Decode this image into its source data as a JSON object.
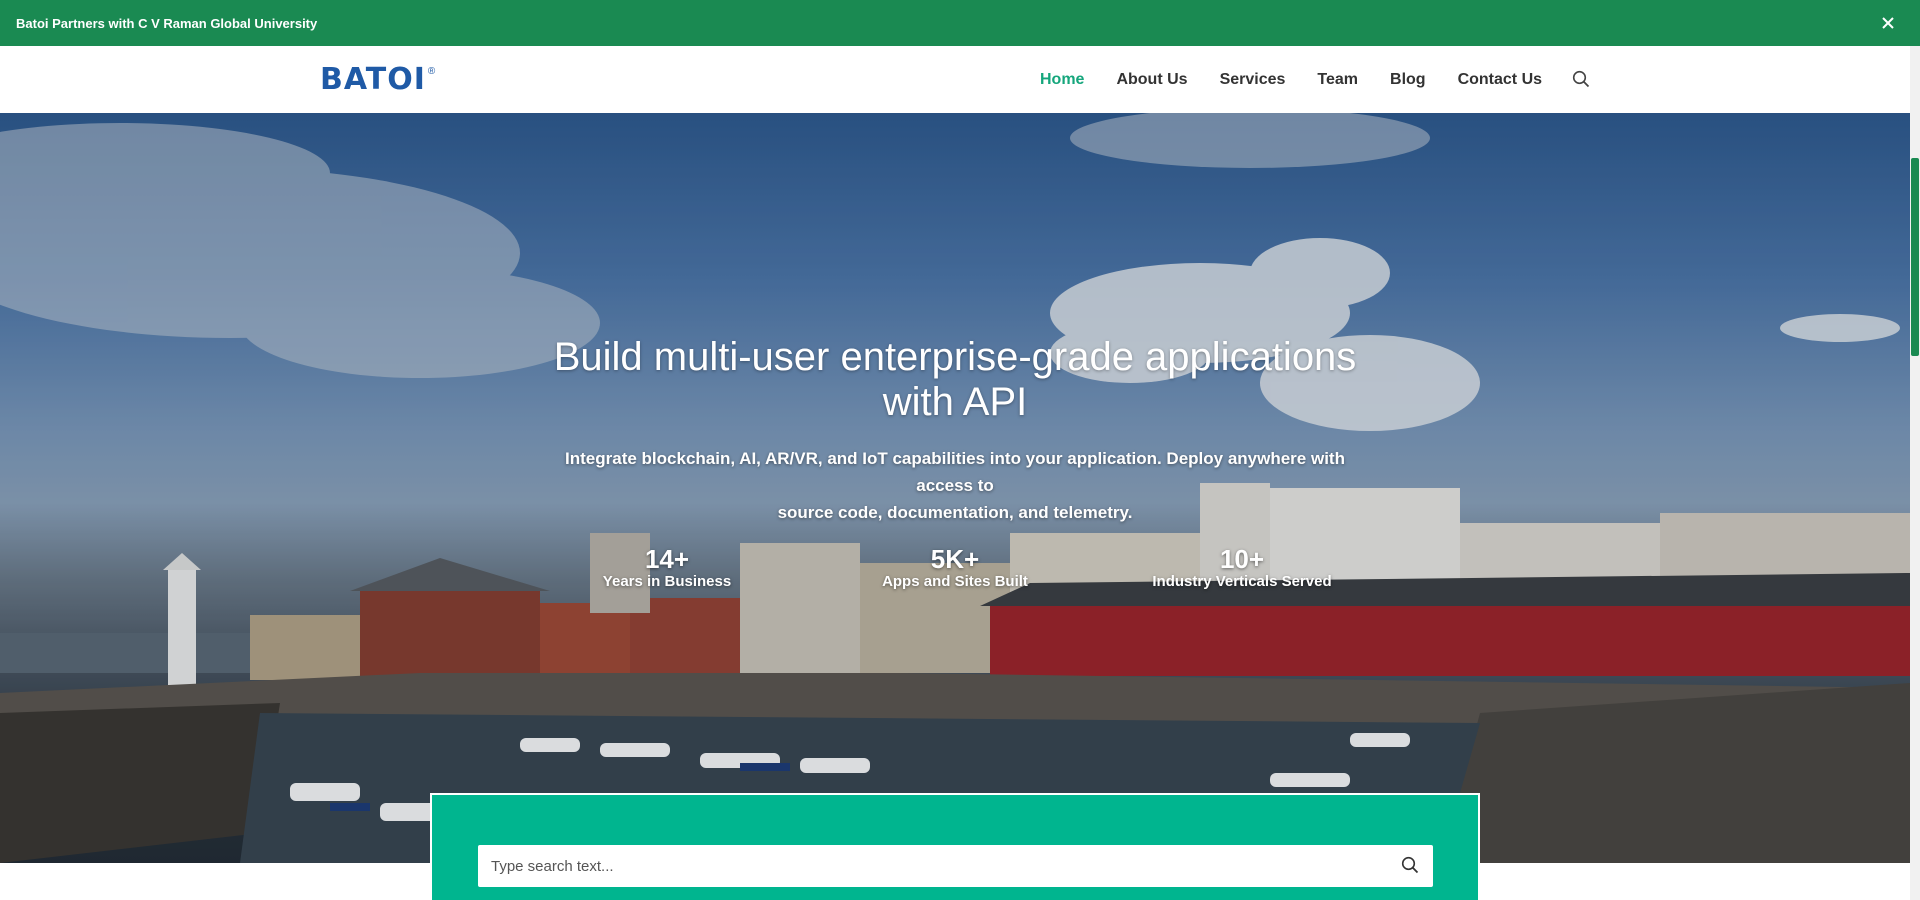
{
  "announcement": {
    "text": "Batoi Partners with C V Raman Global University",
    "close_icon": "close-icon"
  },
  "header": {
    "logo_text": "BATOI",
    "logo_mark": "®",
    "nav": [
      {
        "label": "Home",
        "active": true
      },
      {
        "label": "About Us",
        "active": false
      },
      {
        "label": "Services",
        "active": false
      },
      {
        "label": "Team",
        "active": false
      },
      {
        "label": "Blog",
        "active": false
      },
      {
        "label": "Contact Us",
        "active": false
      }
    ],
    "search_icon": "search-icon"
  },
  "hero": {
    "title_line1": "Build multi-user enterprise-grade applications",
    "title_line2": "with API",
    "subtitle_line1": "Integrate blockchain, AI, AR/VR, and IoT capabilities into your application. Deploy anywhere with access to",
    "subtitle_line2": "source code, documentation, and telemetry.",
    "stats": [
      {
        "value": "14+",
        "label": "Years in Business"
      },
      {
        "value": "5K+",
        "label": "Apps and Sites Built"
      },
      {
        "value": "10+",
        "label": "Industry Verticals Served"
      }
    ]
  },
  "search": {
    "placeholder": "Type search text...",
    "value": ""
  },
  "colors": {
    "announcement_bg": "#1a8a52",
    "nav_active": "#15a67c",
    "search_panel_bg": "#00b58f",
    "logo_blue": "#1f5aa6"
  }
}
